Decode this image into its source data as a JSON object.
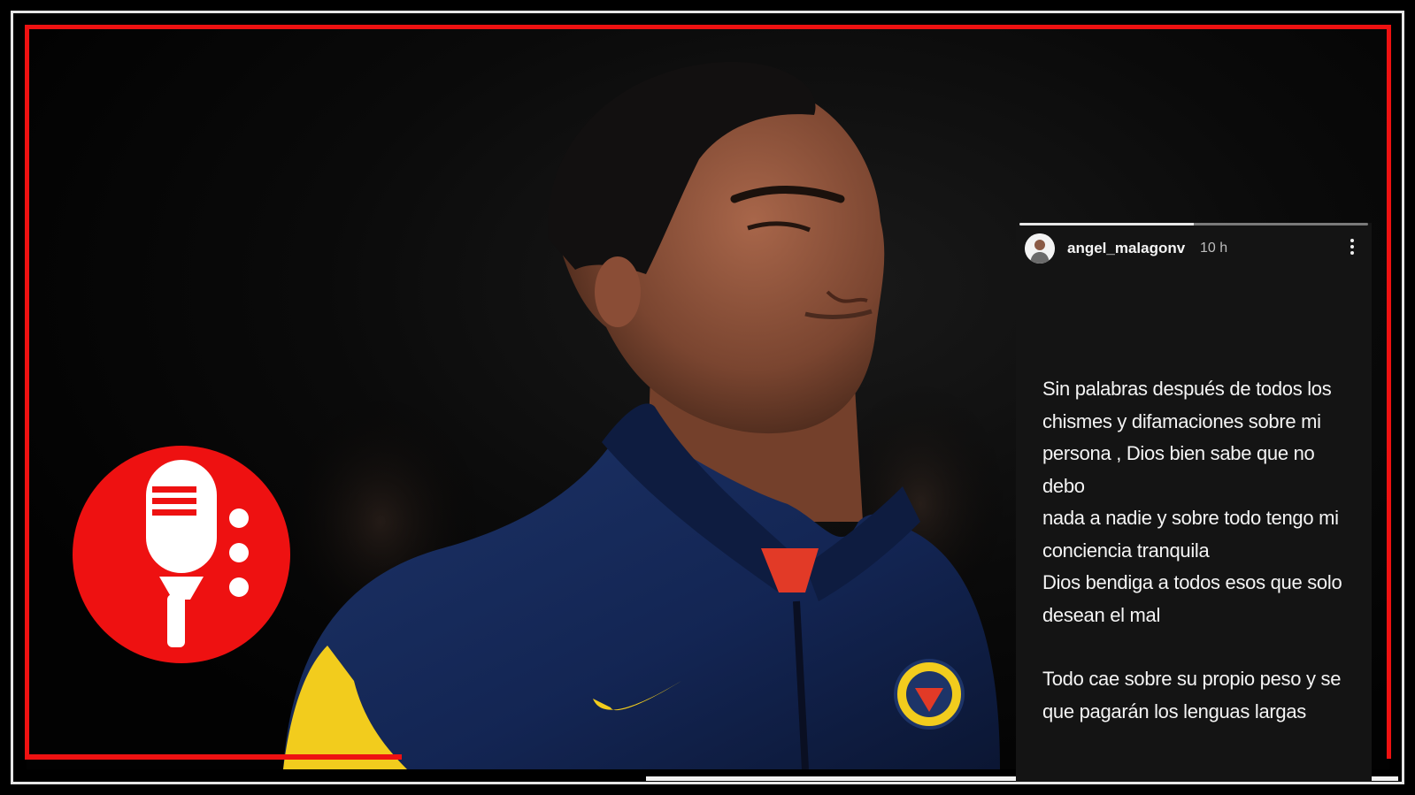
{
  "colors": {
    "frame_red": "#ee1111",
    "frame_white": "#e6e6e6",
    "story_bg": "#141414",
    "logo_red": "#ee1111",
    "jacket_navy": "#14244e",
    "club_yellow": "#f2cc1d"
  },
  "logo": {
    "icon": "microphone-icon"
  },
  "story": {
    "progress": 0.5,
    "username": "angel_malagonv",
    "time": "10 h",
    "more_icon": "more-vertical-icon",
    "lines": [
      "Sin palabras después de todos los",
      "chismes y difamaciones sobre mi",
      "persona , Dios bien sabe que no debo",
      "nada a nadie y sobre todo tengo mi",
      "conciencia tranquila",
      "Dios bendiga a todos esos que solo",
      "desean el mal"
    ],
    "lines2": [
      "Todo cae sobre su propio peso y se",
      "que pagarán los lenguas largas"
    ]
  }
}
